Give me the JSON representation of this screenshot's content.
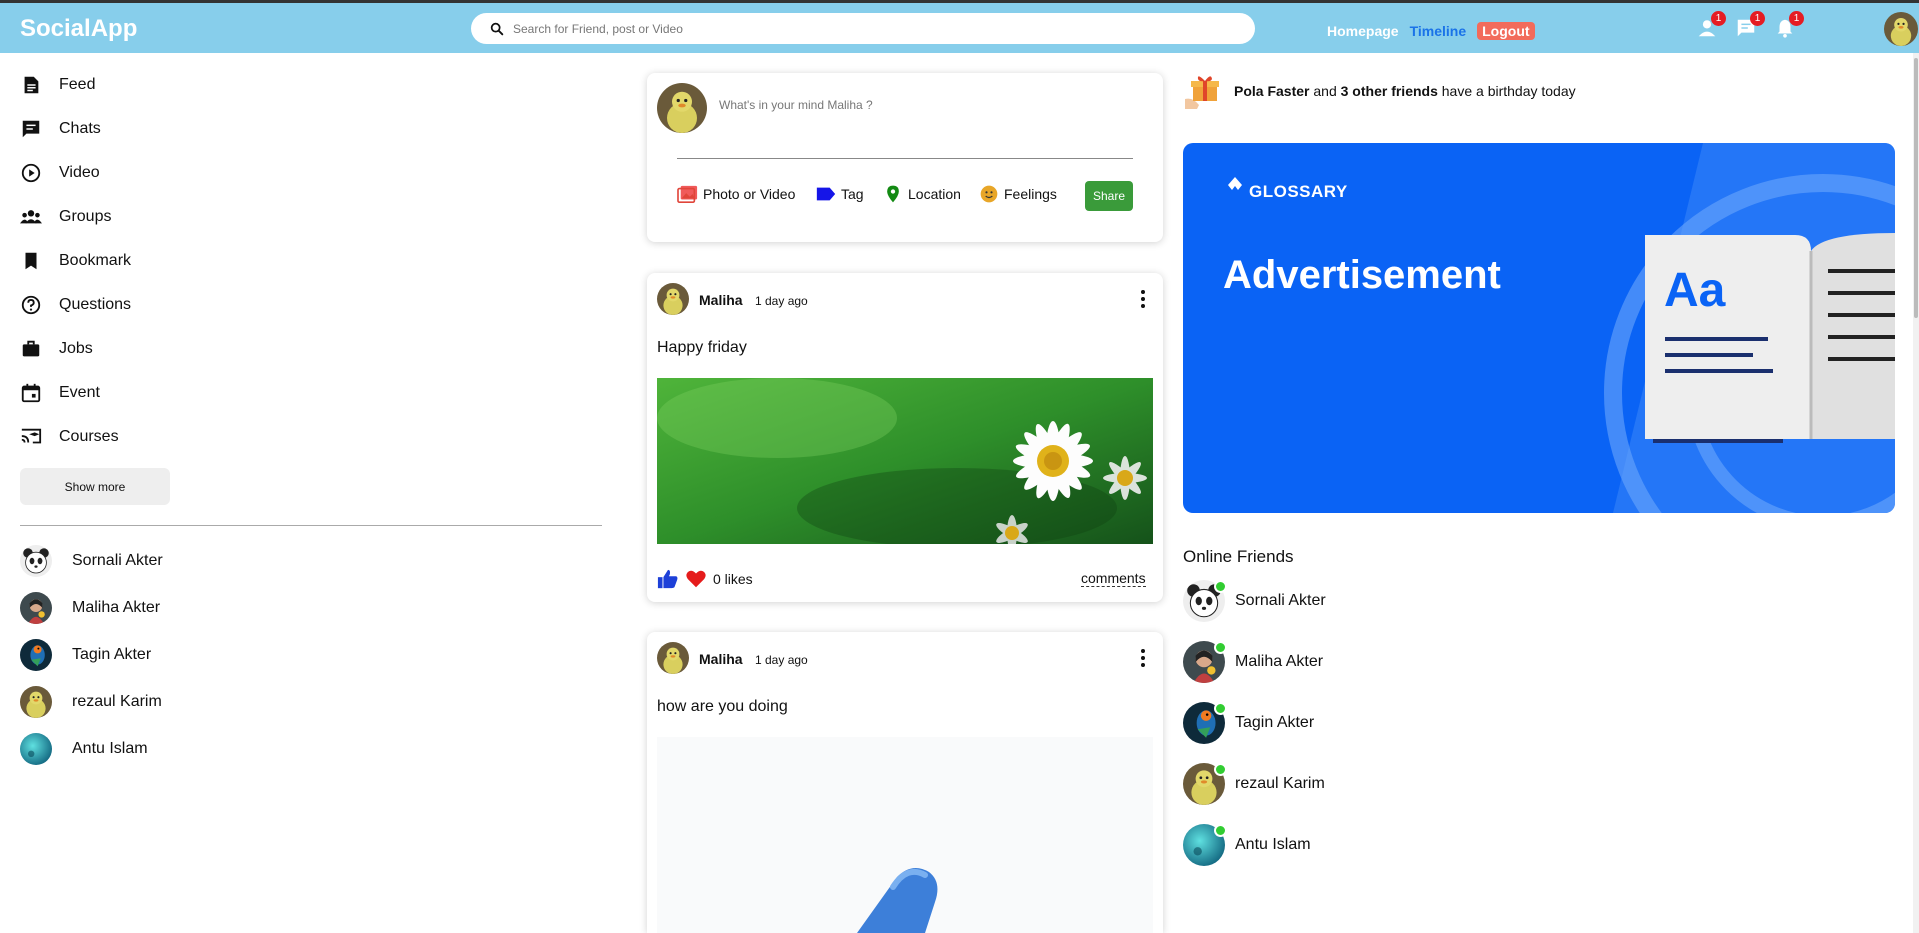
{
  "header": {
    "logo": "SocialApp",
    "search_placeholder": "Search for Friend, post or Video",
    "links": {
      "homepage": "Homepage",
      "timeline": "Timeline",
      "logout": "Logout"
    },
    "badges": {
      "friends": "1",
      "messages": "1",
      "notifications": "1"
    }
  },
  "sidebar": {
    "items": [
      {
        "label": "Feed",
        "icon": "feed-icon"
      },
      {
        "label": "Chats",
        "icon": "chat-icon"
      },
      {
        "label": "Video",
        "icon": "play-circle-icon"
      },
      {
        "label": "Groups",
        "icon": "groups-icon"
      },
      {
        "label": "Bookmark",
        "icon": "bookmark-icon"
      },
      {
        "label": "Questions",
        "icon": "help-circle-icon"
      },
      {
        "label": "Jobs",
        "icon": "briefcase-icon"
      },
      {
        "label": "Event",
        "icon": "calendar-icon"
      },
      {
        "label": "Courses",
        "icon": "school-icon"
      }
    ],
    "show_more": "Show more",
    "friends": [
      "Sornali Akter",
      "Maliha Akter",
      "Tagin Akter",
      "rezaul Karim",
      "Antu Islam"
    ]
  },
  "share": {
    "placeholder": "What's in your mind Maliha ?",
    "options": {
      "photo": "Photo or Video",
      "tag": "Tag",
      "location": "Location",
      "feelings": "Feelings"
    },
    "share_button": "Share"
  },
  "posts": [
    {
      "user": "Maliha",
      "time": "1 day ago",
      "text": "Happy friday",
      "likes": "0 likes",
      "comments": "comments"
    },
    {
      "user": "Maliha",
      "time": "1 day ago",
      "text": "how are you doing"
    }
  ],
  "right": {
    "birthday": {
      "name": "Pola Faster",
      "and": "and",
      "friends": "3 other friends",
      "suffix": "have a birthday today"
    },
    "ad": {
      "brand": "GLOSSARY",
      "title": "Advertisement",
      "letters": "Aa"
    },
    "online_title": "Online Friends",
    "online": [
      "Sornali Akter",
      "Maliha Akter",
      "Tagin Akter",
      "rezaul Karim",
      "Antu Islam"
    ]
  },
  "colors": {
    "header": "#87ceeb",
    "timeline": "#1a73e8",
    "logout": "#f26b5b",
    "share": "#3a9b3a",
    "online": "#32cd32",
    "ad": "#0a63f5"
  }
}
